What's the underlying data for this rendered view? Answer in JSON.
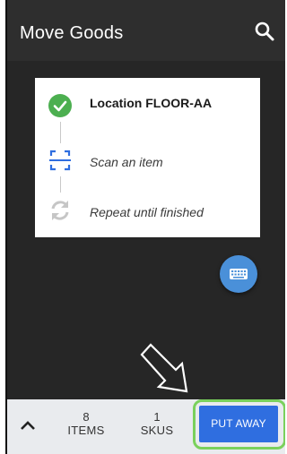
{
  "header": {
    "title": "Move Goods",
    "search_icon": "search-icon"
  },
  "steps": [
    {
      "label": "Location FLOOR-AA",
      "icon": "check-circle-icon",
      "status": "done"
    },
    {
      "label": "Scan an item",
      "icon": "scan-icon",
      "status": "current"
    },
    {
      "label": "Repeat until finished",
      "icon": "refresh-icon",
      "status": "pending"
    }
  ],
  "fab": {
    "icon": "keyboard-icon"
  },
  "bottom_bar": {
    "items_count": "8",
    "items_label": "ITEMS",
    "skus_count": "1",
    "skus_label": "SKUS",
    "put_away_label": "PUT AWAY"
  },
  "colors": {
    "accent": "#2f6ee0",
    "success": "#4caf50",
    "highlight": "#7ad15c",
    "fab": "#4a90d9"
  }
}
